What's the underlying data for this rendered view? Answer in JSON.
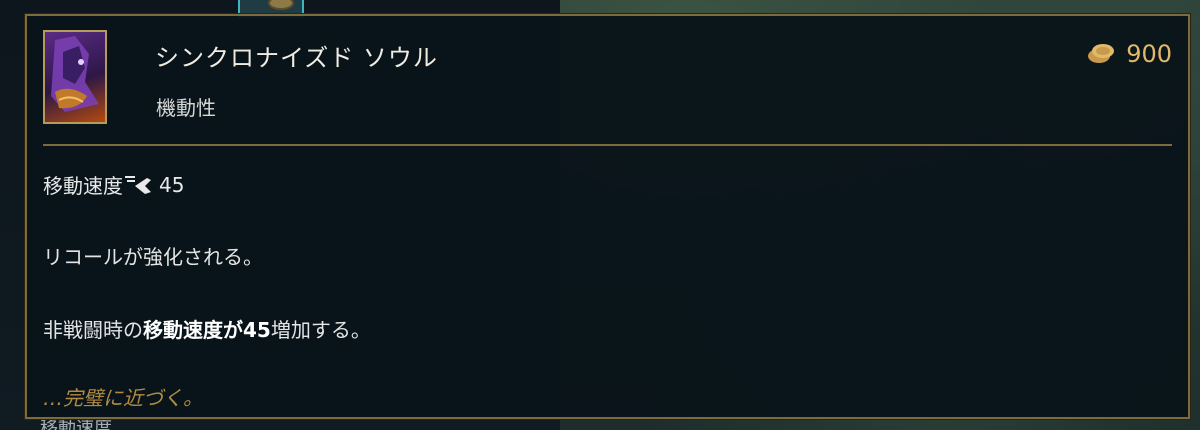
{
  "item": {
    "name": "シンクロナイズド ソウル",
    "category": "機動性",
    "cost": "900",
    "stat": {
      "label": "移動速度",
      "value": "45"
    },
    "description_1": "リコールが強化される。",
    "description_2": {
      "prefix": "非戦闘時の",
      "highlight": "移動速度が45",
      "suffix": "増加する。"
    },
    "flavor": "…完璧に近づく。"
  },
  "icons": {
    "item_icon": "synchronized-souls-boots-icon",
    "gold_icon": "gold-coin-icon",
    "move_speed_icon": "boot-speed-icon"
  },
  "colors": {
    "border_gold": "#7d6a3d",
    "cost_gold": "#e1b96a",
    "flavor_gold": "#b28b43",
    "panel_bg": "#09141a"
  },
  "background": {
    "partial_text": "移動速度"
  }
}
